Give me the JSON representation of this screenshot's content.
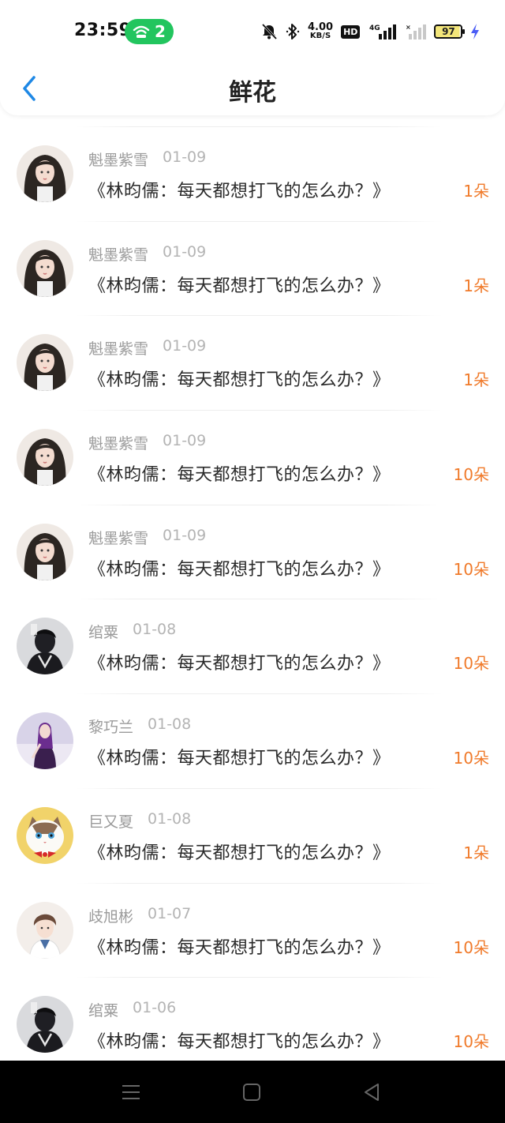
{
  "status_bar": {
    "time": "23:59",
    "hotspot_count": "2",
    "speed_value": "4.00",
    "speed_unit": "KB/S",
    "hd": "HD",
    "network": "4G",
    "battery": "97",
    "accent": "#22c55e"
  },
  "header": {
    "title": "鲜花",
    "back_icon": "chevron-left-icon",
    "back_color": "#1e88e5"
  },
  "items": [
    {
      "user": "魁墨紫雪",
      "date": "01-09",
      "book": "《林昀儒：每天都想打飞的怎么办？》",
      "amount": "1朵",
      "avatar": "girl-long-hair"
    },
    {
      "user": "魁墨紫雪",
      "date": "01-09",
      "book": "《林昀儒：每天都想打飞的怎么办？》",
      "amount": "1朵",
      "avatar": "girl-long-hair"
    },
    {
      "user": "魁墨紫雪",
      "date": "01-09",
      "book": "《林昀儒：每天都想打飞的怎么办？》",
      "amount": "1朵",
      "avatar": "girl-long-hair"
    },
    {
      "user": "魁墨紫雪",
      "date": "01-09",
      "book": "《林昀儒：每天都想打飞的怎么办？》",
      "amount": "10朵",
      "avatar": "girl-long-hair"
    },
    {
      "user": "魁墨紫雪",
      "date": "01-09",
      "book": "《林昀儒：每天都想打飞的怎么办？》",
      "amount": "10朵",
      "avatar": "girl-long-hair"
    },
    {
      "user": "绾粟",
      "date": "01-08",
      "book": "《林昀儒：每天都想打飞的怎么办？》",
      "amount": "10朵",
      "avatar": "boy-dark"
    },
    {
      "user": "黎巧兰",
      "date": "01-08",
      "book": "《林昀儒：每天都想打飞的怎么办？》",
      "amount": "10朵",
      "avatar": "woman-purple"
    },
    {
      "user": "巨又夏",
      "date": "01-08",
      "book": "《林昀儒：每天都想打飞的怎么办？》",
      "amount": "1朵",
      "avatar": "cat"
    },
    {
      "user": "歧旭彬",
      "date": "01-07",
      "book": "《林昀儒：每天都想打飞的怎么办？》",
      "amount": "10朵",
      "avatar": "anime-boy"
    },
    {
      "user": "绾粟",
      "date": "01-06",
      "book": "《林昀儒：每天都想打飞的怎么办？》",
      "amount": "10朵",
      "avatar": "boy-dark"
    }
  ],
  "colors": {
    "amount": "#f07a2a",
    "username": "#9b9b9b",
    "date": "#b4b4b4"
  },
  "system_nav": {
    "menu_icon": "menu-icon",
    "home_icon": "home-square-icon",
    "back_icon": "back-triangle-icon"
  }
}
